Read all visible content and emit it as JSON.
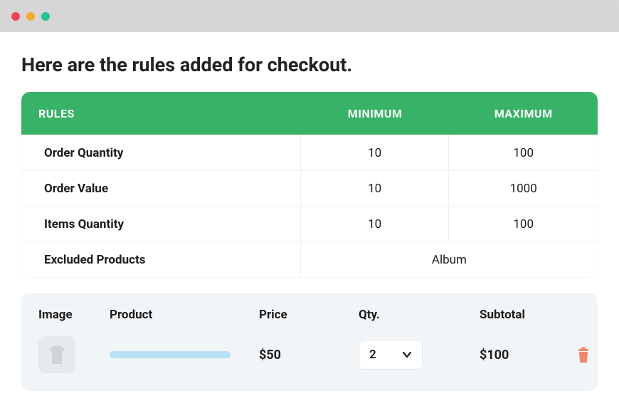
{
  "page": {
    "title": "Here are the rules added for checkout."
  },
  "rules_table": {
    "headers": {
      "rules": "RULES",
      "min": "MINIMUM",
      "max": "MAXIMUM"
    },
    "rows": [
      {
        "name": "Order Quantity",
        "min": "10",
        "max": "100"
      },
      {
        "name": "Order Value",
        "min": "10",
        "max": "1000"
      },
      {
        "name": "Items Quantity",
        "min": "10",
        "max": "100"
      }
    ],
    "excluded": {
      "name": "Excluded Products",
      "value": "Album"
    }
  },
  "cart": {
    "headers": {
      "image": "Image",
      "product": "Product",
      "price": "Price",
      "qty": "Qty.",
      "subtotal": "Subtotal"
    },
    "items": [
      {
        "product_placeholder": true,
        "price": "$50",
        "qty": "2",
        "subtotal": "$100"
      }
    ]
  }
}
